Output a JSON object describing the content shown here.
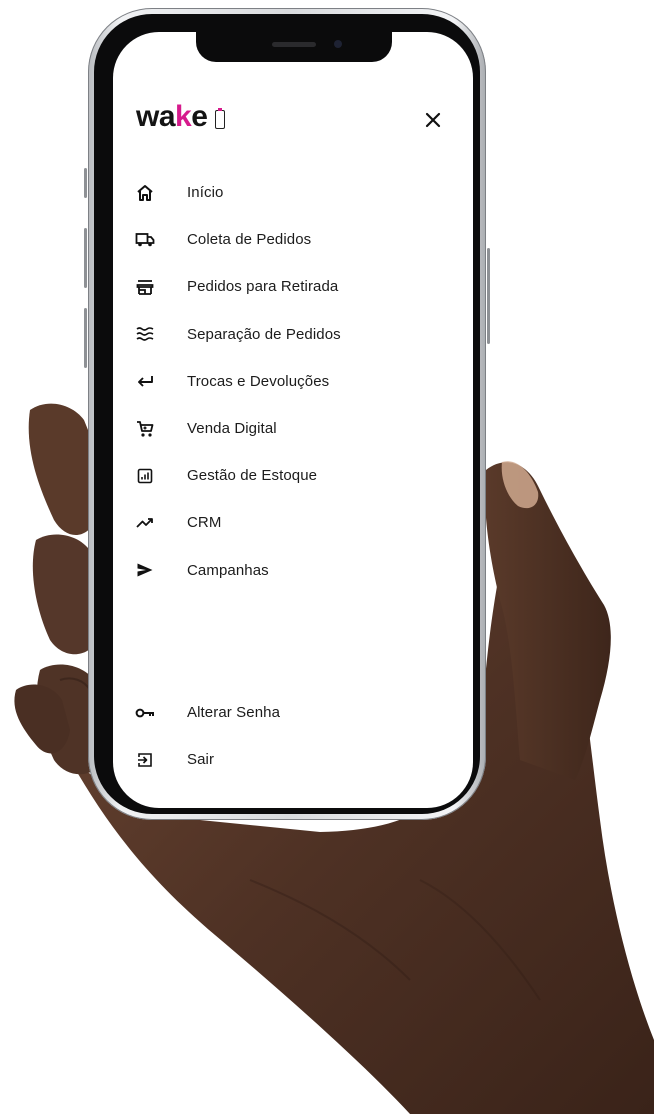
{
  "brand": {
    "wordmark_pre": "wa",
    "wordmark_accent": "k",
    "wordmark_post": "e",
    "accent_color": "#d61a8c"
  },
  "header": {
    "close_icon": "close-icon"
  },
  "menu": {
    "items": [
      {
        "label": "Início",
        "icon": "home-icon"
      },
      {
        "label": "Coleta de Pedidos",
        "icon": "truck-icon"
      },
      {
        "label": "Pedidos para Retirada",
        "icon": "store-icon"
      },
      {
        "label": "Separação de Pedidos",
        "icon": "waves-icon"
      },
      {
        "label": "Trocas e Devoluções",
        "icon": "return-arrow-icon"
      },
      {
        "label": "Venda Digital",
        "icon": "cart-icon"
      },
      {
        "label": "Gestão de Estoque",
        "icon": "inventory-chart-icon"
      },
      {
        "label": "CRM",
        "icon": "trending-up-icon"
      },
      {
        "label": "Campanhas",
        "icon": "send-icon"
      }
    ],
    "bottom_items": [
      {
        "label": "Alterar Senha",
        "icon": "key-icon"
      },
      {
        "label": "Sair",
        "icon": "logout-icon"
      }
    ]
  }
}
